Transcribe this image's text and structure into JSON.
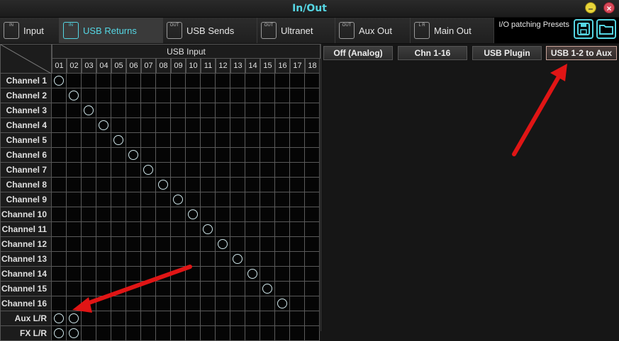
{
  "window": {
    "title": "In/Out",
    "minimize_label": "–",
    "close_label": "×"
  },
  "tabs": [
    {
      "label": "Input",
      "icon": "input-icon",
      "icon_text": "IN"
    },
    {
      "label": "USB Returns",
      "icon": "usb-returns-icon",
      "icon_text": "IN",
      "active": true
    },
    {
      "label": "USB Sends",
      "icon": "usb-sends-icon",
      "icon_text": "OUT"
    },
    {
      "label": "Ultranet",
      "icon": "ultranet-icon",
      "icon_text": "OUT"
    },
    {
      "label": "Aux Out",
      "icon": "aux-out-icon",
      "icon_text": "OUT"
    },
    {
      "label": "Main Out",
      "icon": "main-out-icon",
      "icon_text": "L R"
    }
  ],
  "presets": {
    "label": "I/O patching Presets",
    "save_icon": "save-icon",
    "folder_icon": "folder-icon"
  },
  "matrix": {
    "header": "USB Input",
    "columns": [
      "01",
      "02",
      "03",
      "04",
      "05",
      "06",
      "07",
      "08",
      "09",
      "10",
      "11",
      "12",
      "13",
      "14",
      "15",
      "16",
      "17",
      "18"
    ],
    "rows": [
      "Channel 1",
      "Channel 2",
      "Channel 3",
      "Channel 4",
      "Channel 5",
      "Channel 6",
      "Channel 7",
      "Channel 8",
      "Channel 9",
      "Channel 10",
      "Channel 11",
      "Channel 12",
      "Channel 13",
      "Channel 14",
      "Channel 15",
      "Channel 16",
      "Aux L/R",
      "FX L/R"
    ],
    "routes": [
      [
        0,
        0
      ],
      [
        1,
        1
      ],
      [
        2,
        2
      ],
      [
        3,
        3
      ],
      [
        4,
        4
      ],
      [
        5,
        5
      ],
      [
        6,
        6
      ],
      [
        7,
        7
      ],
      [
        8,
        8
      ],
      [
        9,
        9
      ],
      [
        10,
        10
      ],
      [
        11,
        11
      ],
      [
        12,
        12
      ],
      [
        13,
        13
      ],
      [
        14,
        14
      ],
      [
        15,
        15
      ],
      [
        16,
        0
      ],
      [
        16,
        1
      ],
      [
        17,
        0
      ],
      [
        17,
        1
      ]
    ]
  },
  "preset_buttons": [
    {
      "label": "Off (Analog)"
    },
    {
      "label": "Chn 1-16"
    },
    {
      "label": "USB Plugin"
    },
    {
      "label": "USB 1-2 to Aux",
      "highlighted": true
    }
  ],
  "colors": {
    "accent": "#55d6e3",
    "arrow": "#e01515"
  }
}
